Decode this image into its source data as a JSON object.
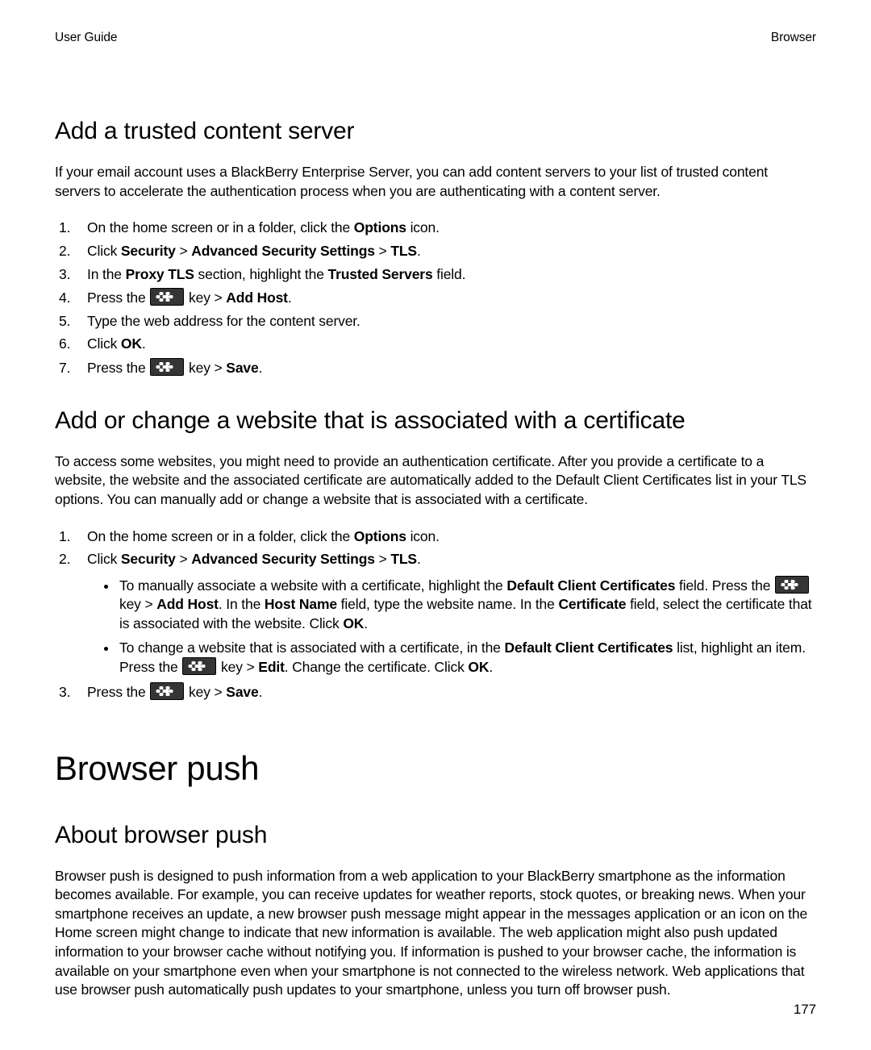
{
  "header": {
    "left": "User Guide",
    "right": "Browser"
  },
  "page_number": "177",
  "sec1": {
    "title": "Add a trusted content server",
    "intro": "If your email account uses a BlackBerry Enterprise Server, you can add content servers to your list of trusted content servers to accelerate the authentication process when you are authenticating with a content server.",
    "step1_a": "On the home screen or in a folder, click the ",
    "step1_b": "Options",
    "step1_c": " icon.",
    "step2_a": "Click ",
    "step2_b": "Security",
    "step2_c": " > ",
    "step2_d": "Advanced Security Settings",
    "step2_e": " > ",
    "step2_f": "TLS",
    "step2_g": ".",
    "step3_a": "In the ",
    "step3_b": "Proxy TLS",
    "step3_c": " section, highlight the ",
    "step3_d": "Trusted Servers",
    "step3_e": " field.",
    "step4_a": "Press the ",
    "step4_b": " key > ",
    "step4_c": "Add Host",
    "step4_d": ".",
    "step5": "Type the web address for the content server.",
    "step6_a": "Click ",
    "step6_b": "OK",
    "step6_c": ".",
    "step7_a": "Press the ",
    "step7_b": " key > ",
    "step7_c": "Save",
    "step7_d": "."
  },
  "sec2": {
    "title": "Add or change a website that is associated with a certificate",
    "intro": "To access some websites, you might need to provide an authentication certificate. After you provide a certificate to a website, the website and the associated certificate are automatically added to the Default Client Certificates list in your TLS options. You can manually add or change a website that is associated with a certificate.",
    "step1_a": "On the home screen or in a folder, click the ",
    "step1_b": "Options",
    "step1_c": " icon.",
    "step2_a": "Click ",
    "step2_b": "Security",
    "step2_c": " > ",
    "step2_d": "Advanced Security Settings",
    "step2_e": " > ",
    "step2_f": "TLS",
    "step2_g": ".",
    "b1_a": "To manually associate a website with a certificate, highlight the ",
    "b1_b": "Default Client Certificates",
    "b1_c": " field. Press the ",
    "b1_d": " key > ",
    "b1_e": "Add Host",
    "b1_f": ". In the ",
    "b1_g": "Host Name",
    "b1_h": " field, type the website name. In the ",
    "b1_i": "Certificate",
    "b1_j": " field, select the certificate that is associated with the website. Click ",
    "b1_k": "OK",
    "b1_l": ".",
    "b2_a": "To change a website that is associated with a certificate, in the ",
    "b2_b": "Default Client Certificates",
    "b2_c": " list, highlight an item. Press the ",
    "b2_d": " key > ",
    "b2_e": "Edit",
    "b2_f": ". Change the certificate. Click ",
    "b2_g": "OK",
    "b2_h": ".",
    "step3_a": "Press the ",
    "step3_b": " key > ",
    "step3_c": "Save",
    "step3_d": "."
  },
  "sec3": {
    "chapter": "Browser push",
    "title": "About browser push",
    "body": "Browser push is designed to push information from a web application to your BlackBerry smartphone as the information becomes available. For example, you can receive updates for weather reports, stock quotes, or breaking news. When your smartphone receives an update, a new browser push message might appear in the messages application or an icon on the Home screen might change to indicate that new information is available. The web application might also push updated information to your browser cache without notifying you. If information is pushed to your browser cache, the information is available on your smartphone even when your smartphone is not connected to the wireless network. Web applications that use browser push automatically push updates to your smartphone, unless you turn off browser push."
  }
}
